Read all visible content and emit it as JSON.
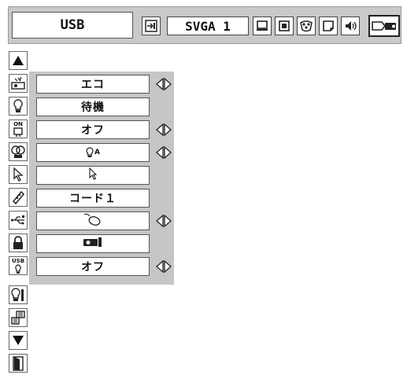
{
  "top_bar": {
    "source_label": "USB",
    "mode_label": "SVGA 1",
    "icons": [
      "input-icon",
      "image-icon",
      "screen-icon",
      "color-icon",
      "picture-icon",
      "sound-icon",
      "setting-icon"
    ]
  },
  "side_icons": [
    "scroll-up-icon",
    "eco-icon",
    "standby-icon",
    "power-on-icon",
    "lamp-icon",
    "pointer-icon",
    "remote-code-icon",
    "usb-mouse-icon",
    "security-lock-icon",
    "usb-power-icon",
    "lamp-replacement-icon",
    "filter-icon",
    "scroll-down-icon",
    "exit-icon"
  ],
  "rows": [
    {
      "value": "エコ",
      "arrows": true
    },
    {
      "value": "待機",
      "arrows": false
    },
    {
      "value": "オフ",
      "arrows": true
    },
    {
      "value_icon": "lamp-auto-icon",
      "value_text": "A",
      "arrows": true
    },
    {
      "value_icon": "pointer-cursor-icon",
      "arrows": false
    },
    {
      "value": "コード１",
      "arrows": false
    },
    {
      "value_icon": "mouse-icon",
      "arrows": true
    },
    {
      "value_icon": "projector-icon",
      "arrows": false
    },
    {
      "value": "オフ",
      "arrows": true
    }
  ],
  "usb_badge": "USB",
  "power_badge": "ON"
}
